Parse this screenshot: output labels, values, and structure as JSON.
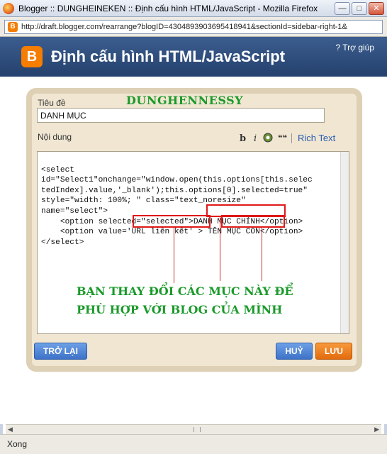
{
  "window": {
    "title": "Blogger :: DUNGHEINEKEN :: Định cấu hình HTML/JavaScript - Mozilla Firefox",
    "url": "http://draft.blogger.com/rearrange?blogID=4304893903695418941&sectionId=sidebar-right-1&",
    "status": "Xong"
  },
  "header": {
    "logo_letter": "B",
    "title": "Định cấu hình HTML/JavaScript",
    "help": "? Trợ giúp"
  },
  "form": {
    "title_label": "Tiêu đề",
    "title_value": "DANH MỤC",
    "content_label": "Nội dung",
    "rich_text": "Rich Text",
    "code_lines": [
      "<select",
      "id=\"Select1\"onchange=\"window.open(this.options[this.selec",
      "tedIndex].value,'_blank');this.options[0].selected=true\"",
      "style=\"width: 100%; \" class=\"text_noresize\"",
      "name=\"select\">",
      "    <option selected=\"selected\">DANH MỤC CHÍNH</option>",
      "    <option value='URL liên kết' > TÊN MỤC CON</option>",
      "</select>"
    ]
  },
  "overlay": {
    "name": "DUNGHENNESSY",
    "annotation": "BẠN THAY ĐỔI CÁC MỤC NÀY ĐỂ PHÙ HỢP VỚI BLOG CỦA MÌNH"
  },
  "buttons": {
    "back": "TRỞ LẠI",
    "cancel": "HUỶ",
    "save": "LƯU"
  },
  "toolbar_icons": {
    "bold": "b",
    "italic": "i",
    "quote": "❝❝"
  },
  "colors": {
    "header_bg": "#2c4a7a",
    "panel_bg": "#f0e6d2",
    "overlay_green": "#1a9a2a",
    "highlight_red": "#e01818",
    "save_orange": "#e26c0d",
    "button_blue": "#3d72c8"
  }
}
